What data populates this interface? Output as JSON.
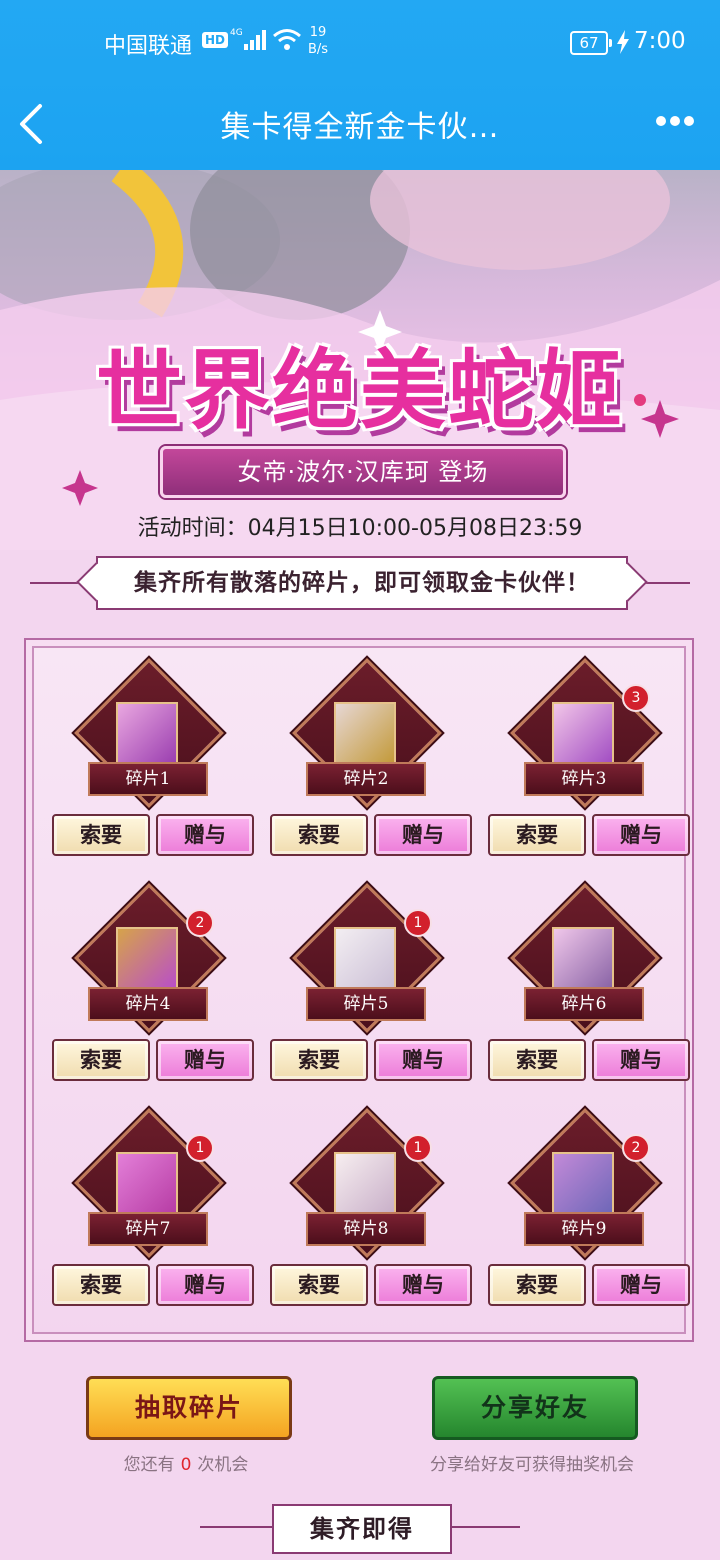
{
  "status_bar": {
    "carrier": "中国联通",
    "hd": "HD",
    "network": "4G",
    "net_speed_value": "19",
    "net_speed_unit": "B/s",
    "battery": "67",
    "time": "7:00"
  },
  "nav": {
    "title": "集卡得全新金卡伙…"
  },
  "banner": {
    "title": "世界绝美蛇姬",
    "subtitle": "女帝·波尔·汉库珂 登场",
    "event_time": "活动时间：04月15日10:00-05月08日23:59"
  },
  "notice": "集齐所有散落的碎片，即可领取金卡伙伴！",
  "fragments": [
    {
      "label": "碎片1",
      "count": "",
      "colors": [
        "#e9a7e0",
        "#9b3fb0"
      ]
    },
    {
      "label": "碎片2",
      "count": "",
      "colors": [
        "#e7d7d4",
        "#c39a3a"
      ]
    },
    {
      "label": "碎片3",
      "count": "3",
      "colors": [
        "#f2c6e8",
        "#a24ec3"
      ]
    },
    {
      "label": "碎片4",
      "count": "2",
      "colors": [
        "#d6a34a",
        "#b94fc7"
      ]
    },
    {
      "label": "碎片5",
      "count": "1",
      "colors": [
        "#f3eef2",
        "#cbbfd6"
      ]
    },
    {
      "label": "碎片6",
      "count": "",
      "colors": [
        "#f0c7ea",
        "#8a64a6"
      ]
    },
    {
      "label": "碎片7",
      "count": "1",
      "colors": [
        "#e37fd8",
        "#b73da5"
      ]
    },
    {
      "label": "碎片8",
      "count": "1",
      "colors": [
        "#f7eef0",
        "#c9b0c9"
      ]
    },
    {
      "label": "碎片9",
      "count": "2",
      "colors": [
        "#c38ad8",
        "#6f67b8"
      ]
    }
  ],
  "buttons": {
    "request": "索要",
    "give": "赠与",
    "draw": "抽取碎片",
    "share": "分享好友"
  },
  "chances": {
    "prefix": "您还有",
    "count": "0",
    "suffix": "次机会"
  },
  "share_hint": "分享给好友可获得抽奖机会",
  "collect_title": "集齐即得",
  "colors": {
    "header_blue": "#1ca3f1",
    "title_pink": "#e62f9f",
    "badge_red": "#d2202c"
  }
}
